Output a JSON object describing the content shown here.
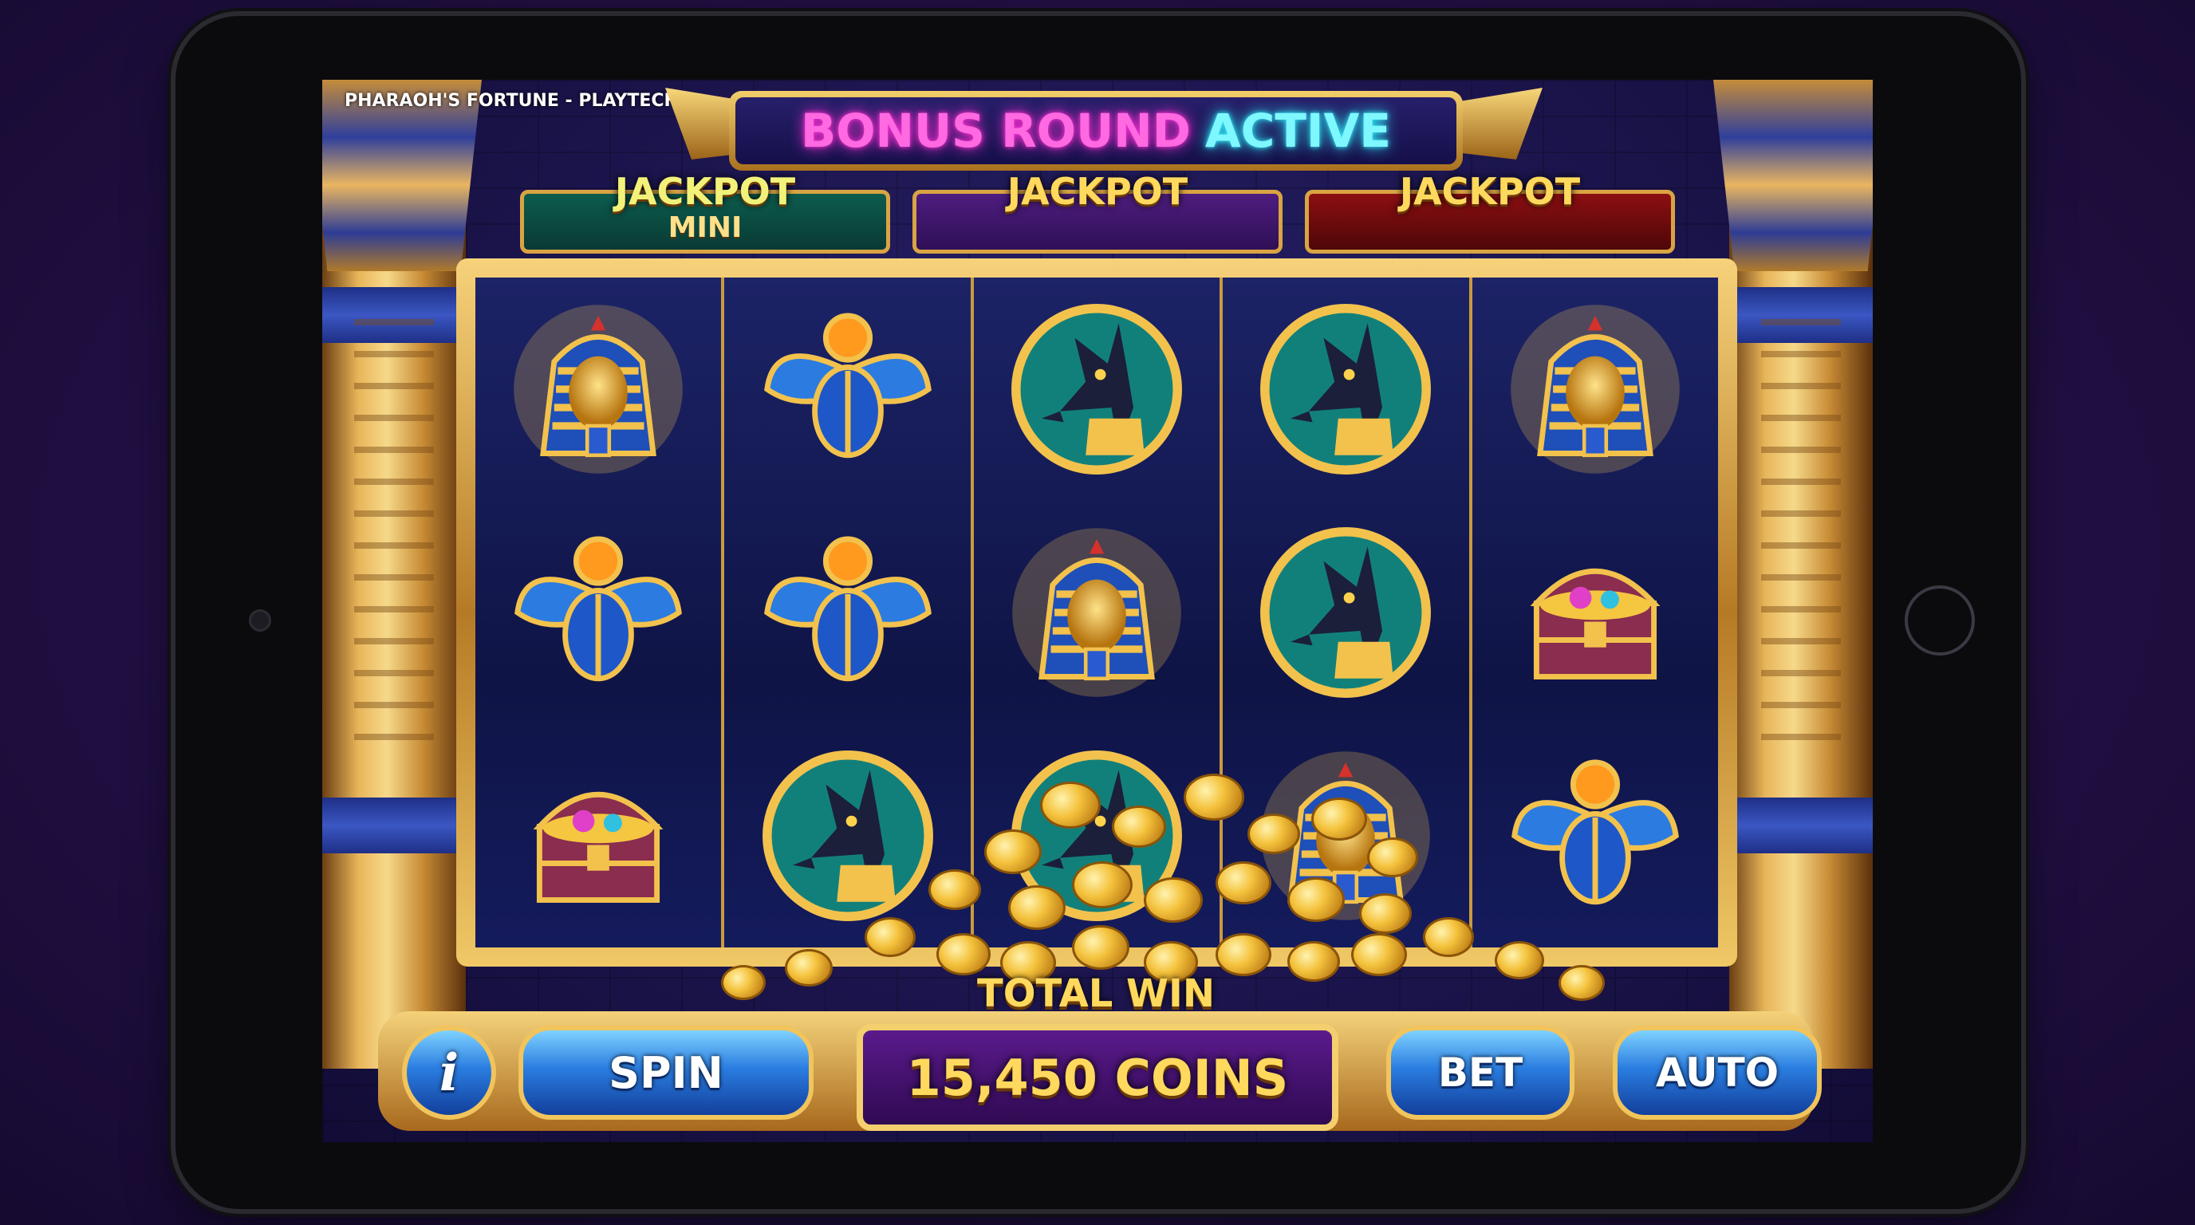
{
  "game": {
    "title": "PHARAOH'S FORTUNE - PLAYTECH"
  },
  "banner": {
    "part1": "BONUS ROUND",
    "part2": "ACTIVE"
  },
  "jackpots": [
    {
      "label": "JACKPOT",
      "sub": "MINI",
      "color": "#0d5c4d"
    },
    {
      "label": "JACKPOT",
      "sub": "",
      "color": "#4e1d7f"
    },
    {
      "label": "JACKPOT",
      "sub": "",
      "color": "#8c0f12"
    }
  ],
  "reels": [
    [
      "pharaoh-icon",
      "scarab-icon",
      "treasure-chest-icon"
    ],
    [
      "scarab-icon",
      "scarab-icon",
      "anubis-icon"
    ],
    [
      "anubis-icon",
      "pharaoh-icon",
      "anubis-icon"
    ],
    [
      "anubis-icon",
      "anubis-icon",
      "pharaoh-icon"
    ],
    [
      "pharaoh-icon",
      "treasure-chest-icon",
      "scarab-icon"
    ]
  ],
  "win": {
    "label": "TOTAL WIN",
    "value": "15,450 COINS"
  },
  "controls": {
    "info": "i",
    "spin": "SPIN",
    "bet": "BET",
    "auto": "AUTO"
  },
  "colors": {
    "gold": "#f4cf6e",
    "button_blue": "#2a7de0",
    "neon_pink": "#ff69e1",
    "neon_cyan": "#7ff7ff"
  }
}
